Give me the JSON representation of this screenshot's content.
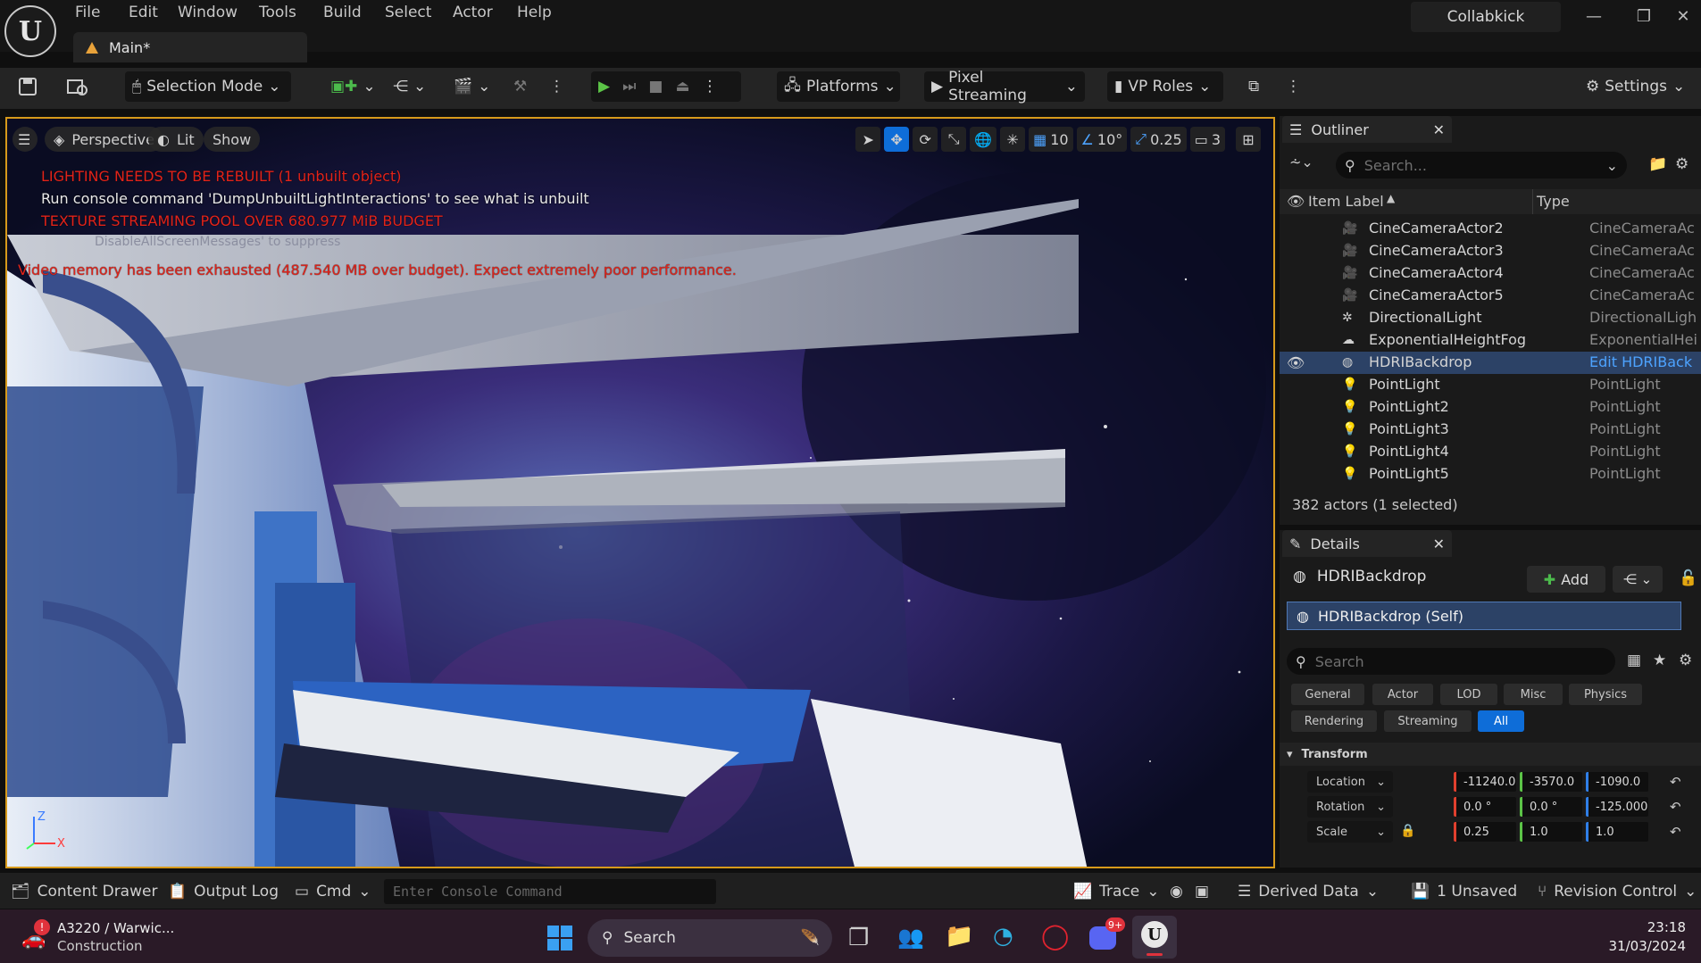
{
  "app": {
    "logo": "ue-logo",
    "menu": [
      "File",
      "Edit",
      "Window",
      "Tools",
      "Build",
      "Select",
      "Actor",
      "Help"
    ],
    "tab": "Main*",
    "session": "Collabkick"
  },
  "toolbar": {
    "selection_mode": "Selection Mode",
    "platforms": "Platforms",
    "pixel_streaming": "Pixel Streaming",
    "vp_roles": "VP Roles",
    "settings": "Settings"
  },
  "viewport": {
    "perspective": "Perspective",
    "lit": "Lit",
    "show": "Show",
    "grid_snap": "10",
    "rotation_snap": "10°",
    "scale_snap": "0.25",
    "camera_speed": "3",
    "messages": {
      "lighting": "LIGHTING NEEDS TO BE REBUILT (1 unbuilt object)",
      "console": "Run console command 'DumpUnbuiltLightInteractions' to see what is unbuilt",
      "texture": "TEXTURE STREAMING POOL OVER 680.977 MiB BUDGET",
      "disable": "DisableAllScreenMessages' to suppress",
      "video": "Video memory has been exhausted (487.540 MB over budget). Expect extremely poor performance."
    }
  },
  "outliner": {
    "title": "Outliner",
    "search_placeholder": "Search...",
    "col_label": "Item Label",
    "col_type": "Type",
    "rows": [
      {
        "label": "CineCameraActor2",
        "type": "CineCameraAc",
        "icon": "camera-icon"
      },
      {
        "label": "CineCameraActor3",
        "type": "CineCameraAc",
        "icon": "camera-icon"
      },
      {
        "label": "CineCameraActor4",
        "type": "CineCameraAc",
        "icon": "camera-icon"
      },
      {
        "label": "CineCameraActor5",
        "type": "CineCameraAc",
        "icon": "camera-icon"
      },
      {
        "label": "DirectionalLight",
        "type": "DirectionalLigh",
        "icon": "sun-icon"
      },
      {
        "label": "ExponentialHeightFog",
        "type": "ExponentialHei",
        "icon": "fog-icon"
      },
      {
        "label": "HDRIBackdrop",
        "type": "Edit HDRIBack",
        "icon": "sphere-icon",
        "selected": true
      },
      {
        "label": "PointLight",
        "type": "PointLight",
        "icon": "bulb-icon"
      },
      {
        "label": "PointLight2",
        "type": "PointLight",
        "icon": "bulb-icon"
      },
      {
        "label": "PointLight3",
        "type": "PointLight",
        "icon": "bulb-icon"
      },
      {
        "label": "PointLight4",
        "type": "PointLight",
        "icon": "bulb-icon"
      },
      {
        "label": "PointLight5",
        "type": "PointLight",
        "icon": "bulb-icon"
      }
    ],
    "status": "382 actors (1 selected)"
  },
  "details": {
    "title": "Details",
    "actor": "HDRIBackdrop",
    "add": "Add",
    "component": "HDRIBackdrop (Self)",
    "search_placeholder": "Search",
    "categories": [
      "General",
      "Actor",
      "LOD",
      "Misc",
      "Physics",
      "Rendering",
      "Streaming",
      "All"
    ],
    "section": "Transform",
    "transform": [
      {
        "label": "Location",
        "x": "-11240.0",
        "y": "-3570.0",
        "z": "-1090.0"
      },
      {
        "label": "Rotation",
        "x": "0.0 °",
        "y": "0.0 °",
        "z": "-125.000"
      },
      {
        "label": "Scale",
        "x": "0.25",
        "y": "1.0",
        "z": "1.0"
      }
    ]
  },
  "bottom": {
    "content_drawer": "Content Drawer",
    "output_log": "Output Log",
    "cmd": "Cmd",
    "console_placeholder": "Enter Console Command",
    "trace": "Trace",
    "derived_data": "Derived Data",
    "unsaved": "1 Unsaved",
    "revision": "Revision Control"
  },
  "taskbar": {
    "weather_title": "A3220 / Warwic...",
    "weather_sub": "Construction",
    "alert_badge": "!",
    "search": "Search",
    "discord_badge": "9+",
    "time": "23:18",
    "date": "31/03/2024"
  },
  "colors": {
    "accent": "#0e6dd8",
    "viewport_border": "#d79a1b",
    "warning_red": "#e2231a",
    "selected_row": "#2c4266",
    "link": "#4da3ff"
  }
}
